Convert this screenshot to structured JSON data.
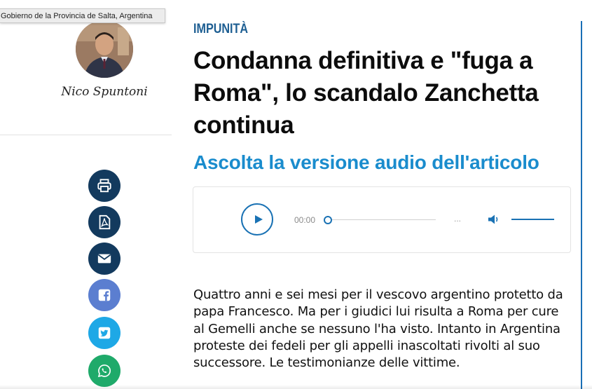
{
  "tooltip": "Gobierno de la Provincia de Salta, Argentina",
  "author": {
    "name": "Nico Spuntoni"
  },
  "share": {
    "icons": [
      "print-icon",
      "pdf-icon",
      "mail-icon",
      "facebook-icon",
      "twitter-icon",
      "whatsapp-icon"
    ],
    "colors": {
      "dark": "#133a5e",
      "facebook": "#5b7ed0",
      "twitter": "#1ea8e6",
      "whatsapp": "#1faa6a"
    }
  },
  "article": {
    "kicker": "IMPUNITÀ",
    "headline_lines": [
      "Condanna definitiva e \"fuga a",
      "Roma\", lo scandalo Zanchetta",
      "continua"
    ],
    "audio_title": "Ascolta la versione audio dell'articolo",
    "summary": "Quattro anni e sei mesi per il vescovo argentino protetto da papa Francesco. Ma per i giudici lui risulta a Roma per cure al Gemelli anche se nessuno l'ha visto. Intanto in Argentina proteste dei fedeli per gli appelli inascoltati rivolti al suo successore. Le testimonianze delle vittime."
  },
  "player": {
    "current_time": "00:00",
    "duration": "...",
    "progress": 0,
    "volume": 1.0,
    "accent": "#1a72b4"
  },
  "colors": {
    "kicker": "#1d5e92",
    "audio_title": "#1a8ccd"
  }
}
